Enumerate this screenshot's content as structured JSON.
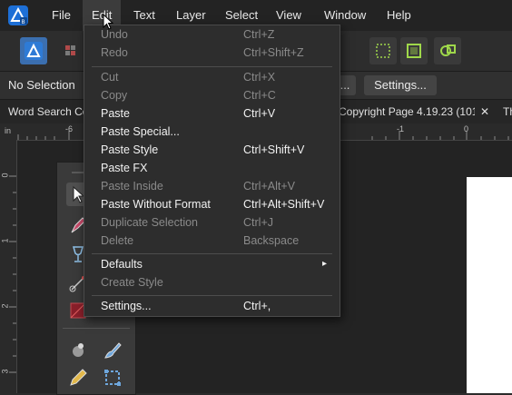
{
  "menubar": {
    "items": [
      "File",
      "Edit",
      "Text",
      "Layer",
      "Select",
      "View",
      "Window",
      "Help"
    ],
    "active": "Edit"
  },
  "contextbar": {
    "selection_text": "No Selection",
    "partial_button": "...",
    "settings_button": "Settings..."
  },
  "tabs": [
    {
      "label": "Word Search Cov"
    },
    {
      "label": "Copyright Page 4.19.23 (101..."
    },
    {
      "label": "Th"
    }
  ],
  "tab_close": "✕",
  "ruler": {
    "h_labels": [
      "in",
      "-6",
      "-1",
      "0"
    ],
    "v_labels": [
      "0",
      "1",
      "2",
      "3"
    ]
  },
  "edit_menu": {
    "undo": {
      "label": "Undo",
      "shortcut": "Ctrl+Z"
    },
    "redo": {
      "label": "Redo",
      "shortcut": "Ctrl+Shift+Z"
    },
    "cut": {
      "label": "Cut",
      "shortcut": "Ctrl+X"
    },
    "copy": {
      "label": "Copy",
      "shortcut": "Ctrl+C"
    },
    "paste": {
      "label": "Paste",
      "shortcut": "Ctrl+V"
    },
    "paste_special": {
      "label": "Paste Special...",
      "shortcut": ""
    },
    "paste_style": {
      "label": "Paste Style",
      "shortcut": "Ctrl+Shift+V"
    },
    "paste_fx": {
      "label": "Paste FX",
      "shortcut": ""
    },
    "paste_inside": {
      "label": "Paste Inside",
      "shortcut": "Ctrl+Alt+V"
    },
    "paste_without_format": {
      "label": "Paste Without Format",
      "shortcut": "Ctrl+Alt+Shift+V"
    },
    "duplicate_selection": {
      "label": "Duplicate Selection",
      "shortcut": "Ctrl+J"
    },
    "delete": {
      "label": "Delete",
      "shortcut": "Backspace"
    },
    "defaults": {
      "label": "Defaults",
      "submenu_arrow": "▸"
    },
    "create_style": {
      "label": "Create Style",
      "shortcut": ""
    },
    "settings": {
      "label": "Settings...",
      "shortcut": "Ctrl+,"
    }
  },
  "colors": {
    "accent": "#2e7bd6",
    "menu_bg": "#2d2d2d",
    "disabled_text": "#8a8a8a",
    "enabled_text": "#f2f2f2"
  }
}
